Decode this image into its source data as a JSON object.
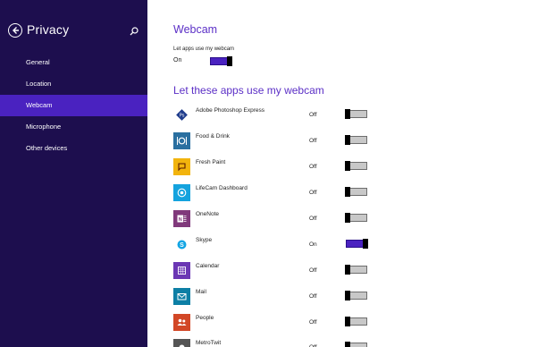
{
  "left_pane": {
    "title": "Privacy",
    "back_icon": "back-arrow-icon",
    "search_icon": "search-icon",
    "nav_items": [
      {
        "label": "General",
        "active": false
      },
      {
        "label": "Location",
        "active": false
      },
      {
        "label": "Webcam",
        "active": true
      },
      {
        "label": "Microphone",
        "active": false
      },
      {
        "label": "Other devices",
        "active": false
      }
    ]
  },
  "main": {
    "heading": "Webcam",
    "master_toggle": {
      "label": "Let apps use my webcam",
      "state": "On",
      "on": true
    },
    "section_heading": "Let these apps use my webcam",
    "apps": [
      {
        "name": "Adobe Photoshop Express",
        "state": "Off",
        "on": false,
        "icon": "photoshop-express-icon",
        "color": "#ffffff"
      },
      {
        "name": "Food & Drink",
        "state": "Off",
        "on": false,
        "icon": "food-drink-icon",
        "color": "#2a6fa0"
      },
      {
        "name": "Fresh Paint",
        "state": "Off",
        "on": false,
        "icon": "fresh-paint-icon",
        "color": "#f2b40d"
      },
      {
        "name": "LifeCam Dashboard",
        "state": "Off",
        "on": false,
        "icon": "lifecam-icon",
        "color": "#14a3de"
      },
      {
        "name": "OneNote",
        "state": "Off",
        "on": false,
        "icon": "onenote-icon",
        "color": "#80397b"
      },
      {
        "name": "Skype",
        "state": "On",
        "on": true,
        "icon": "skype-icon",
        "color": "#ffffff"
      },
      {
        "name": "Calendar",
        "state": "Off",
        "on": false,
        "icon": "calendar-icon",
        "color": "#6b37b4"
      },
      {
        "name": "Mail",
        "state": "Off",
        "on": false,
        "icon": "mail-icon",
        "color": "#0d7fa5"
      },
      {
        "name": "People",
        "state": "Off",
        "on": false,
        "icon": "people-icon",
        "color": "#d24726"
      },
      {
        "name": "MetroTwit",
        "state": "Off",
        "on": false,
        "icon": "metrotwit-icon",
        "color": "#555555"
      }
    ]
  },
  "colors": {
    "left_pane_bg": "#1d0e4e",
    "nav_active_bg": "#4a22c0",
    "accent": "#5b2fc6",
    "toggle_on": "#4a22c0",
    "toggle_off": "#c8c8c8"
  }
}
